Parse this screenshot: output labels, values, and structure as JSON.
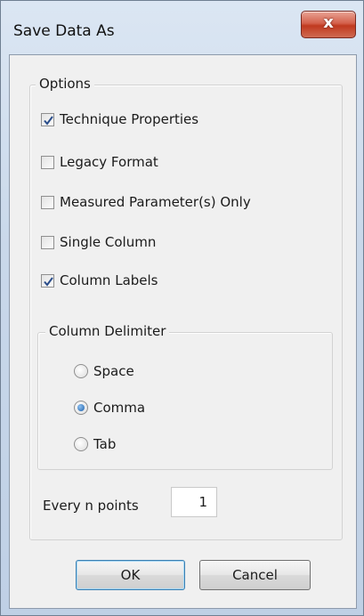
{
  "window": {
    "title": "Save Data As",
    "close_glyph": "x"
  },
  "options_group": {
    "label": "Options",
    "checkboxes": [
      {
        "label": "Technique Properties",
        "checked": true
      },
      {
        "label": "Legacy Format",
        "checked": false
      },
      {
        "label": "Measured Parameter(s) Only",
        "checked": false
      },
      {
        "label": "Single Column",
        "checked": false
      },
      {
        "label": "Column Labels",
        "checked": true
      }
    ]
  },
  "delimiter_group": {
    "label": "Column Delimiter",
    "options": [
      {
        "label": "Space",
        "selected": false
      },
      {
        "label": "Comma",
        "selected": true
      },
      {
        "label": "Tab",
        "selected": false
      }
    ]
  },
  "every_n_points": {
    "label": "Every n points",
    "value": "1"
  },
  "buttons": {
    "ok": "OK",
    "cancel": "Cancel"
  },
  "colors": {
    "accent": "#1c5fa8",
    "close": "#c0391f"
  }
}
